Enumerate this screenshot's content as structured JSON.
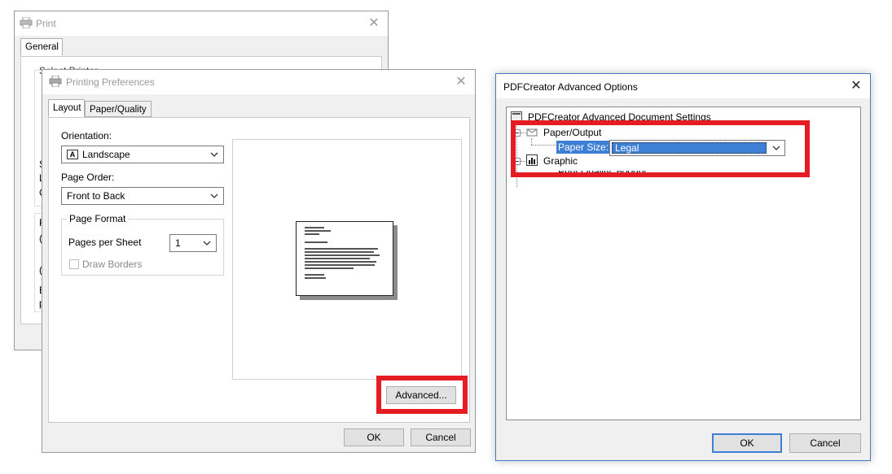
{
  "print_window": {
    "title": "Print",
    "tab_general": "General",
    "partial_label": "Select Printer",
    "edge_letters": [
      "S",
      "L",
      "C",
      "F",
      "(",
      "(",
      "E",
      "p"
    ]
  },
  "prefs_window": {
    "title": "Printing Preferences",
    "tabs": {
      "layout": "Layout",
      "paper_quality": "Paper/Quality"
    },
    "orientation_label": "Orientation:",
    "orientation_value": "Landscape",
    "page_order_label": "Page Order:",
    "page_order_value": "Front to Back",
    "page_format_label": "Page Format",
    "pages_per_sheet_label": "Pages per Sheet",
    "pages_per_sheet_value": "1",
    "draw_borders_label": "Draw Borders",
    "advanced_button": "Advanced...",
    "ok_button": "OK",
    "cancel_button": "Cancel"
  },
  "advanced_window": {
    "title": "PDFCreator Advanced Options",
    "tree_root": "PDFCreator Advanced Document Settings",
    "paper_output_node": "Paper/Output",
    "paper_size_label": "Paper Size:",
    "paper_size_value": "Legal",
    "graphic_node": "Graphic",
    "print_quality_partial": "Print Quality: 600dpi",
    "ok_button": "OK",
    "cancel_button": "Cancel"
  },
  "colors": {
    "highlight": "#e51c24",
    "selection": "#3c7fd4",
    "accent_border": "#4a78c0"
  }
}
